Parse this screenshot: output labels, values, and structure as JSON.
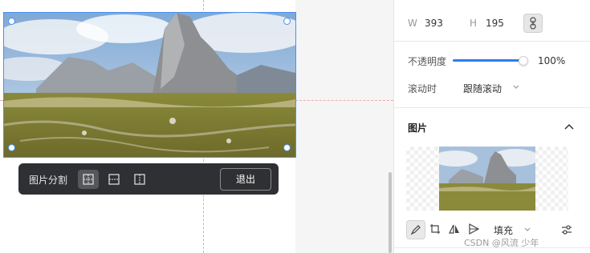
{
  "canvas": {
    "image_alt": "mountain landscape with a tall rocky peak under a cloudy sky",
    "split_toolbar": {
      "label": "图片分割",
      "exit_label": "退出",
      "icons": [
        "grid-split-icon",
        "horizontal-split-icon",
        "vertical-split-icon"
      ]
    }
  },
  "panel": {
    "size": {
      "w_label": "W",
      "w_value": "393",
      "h_label": "H",
      "h_value": "195",
      "lock_icon": "link-icon"
    },
    "opacity": {
      "label": "不透明度",
      "value": "100%",
      "level": 1.0
    },
    "scroll": {
      "label": "滚动时",
      "value": "跟随滚动"
    },
    "image_section": {
      "title": "图片",
      "collapse_icon": "chevron-up-icon",
      "tools": [
        "pen-icon",
        "crop-icon",
        "flip-icon",
        "rotate-icon"
      ],
      "fill_mode": "填充",
      "adjust_icon": "sliders-icon"
    }
  },
  "watermark": "CSDN @风流 少年",
  "colors": {
    "accent": "#2f7bf0",
    "selection": "#4a8ff0",
    "toolbar_bg": "#2f3033",
    "guide": "#f0a8a8"
  }
}
